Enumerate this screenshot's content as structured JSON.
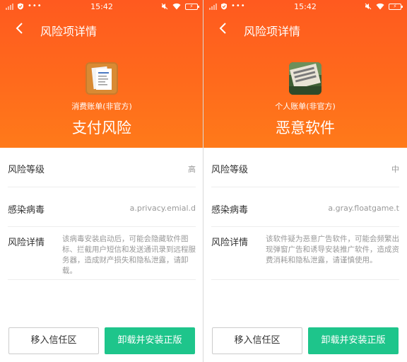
{
  "screens": [
    {
      "status": {
        "time": "15:42",
        "dots": "•••",
        "battery": "⚡"
      },
      "title": "风险项详情",
      "app_name": "消费账单(非官方)",
      "app_icon": "receipt-app-icon",
      "risk_type": "支付风险",
      "rows": {
        "level_label": "风险等级",
        "level_value": "高",
        "virus_label": "感染病毒",
        "virus_value": "a.privacy.emial.d",
        "detail_label": "风险详情",
        "detail_text": "该病毒安装启动后，可能会隐藏软件图标、拦截用户短信和发送通讯录到远程服务器，造成财产损失和隐私泄露，请卸载。"
      },
      "buttons": {
        "trust": "移入信任区",
        "reinstall": "卸载并安装正版"
      }
    },
    {
      "status": {
        "time": "15:42",
        "dots": "•••",
        "battery": "⚡"
      },
      "title": "风险项详情",
      "app_name": "个人账单(非官方)",
      "app_icon": "game-app-icon",
      "risk_type": "恶意软件",
      "rows": {
        "level_label": "风险等级",
        "level_value": "中",
        "virus_label": "感染病毒",
        "virus_value": "a.gray.floatgame.t",
        "detail_label": "风险详情",
        "detail_text": "该软件疑为恶意广告软件，可能会频繁出现弹窗广告和诱导安装推广软件，造成资费消耗和隐私泄露，请谨慎使用。"
      },
      "buttons": {
        "trust": "移入信任区",
        "reinstall": "卸载并安装正版"
      }
    }
  ],
  "colors": {
    "header": "#ff6a1c",
    "primary_button": "#1ec58b"
  }
}
